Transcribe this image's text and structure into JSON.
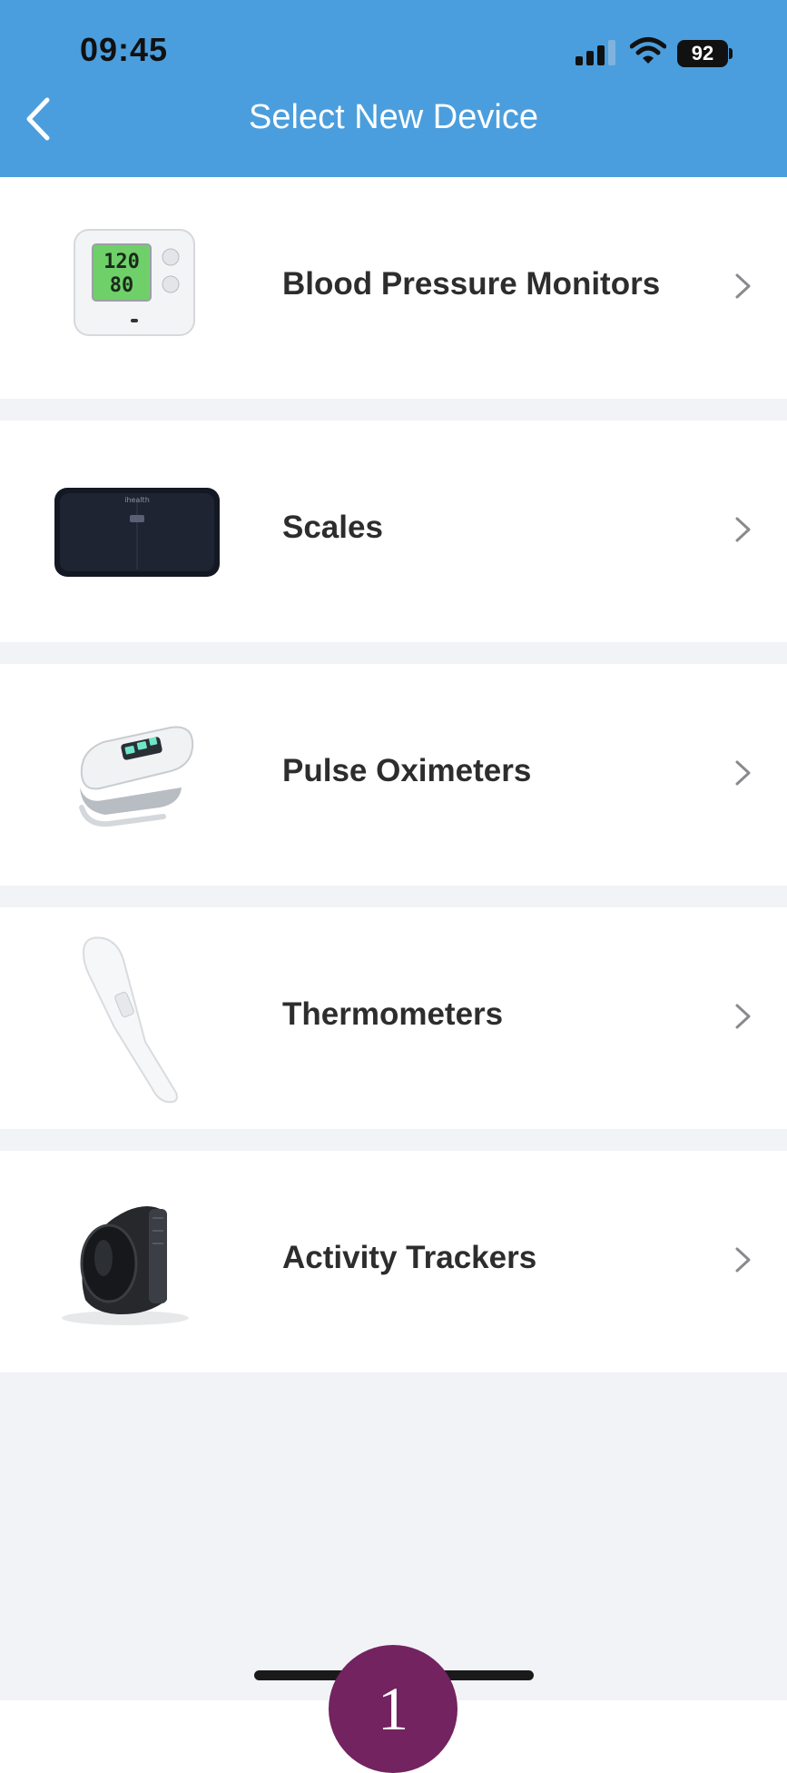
{
  "status_bar": {
    "time": "09:45",
    "battery": "92",
    "icons": [
      "cellular-signal-icon",
      "wifi-icon",
      "battery-icon"
    ]
  },
  "nav": {
    "title": "Select New Device",
    "back_icon": "chevron-left-icon"
  },
  "devices": [
    {
      "label": "Blood Pressure Monitors",
      "image": "blood-pressure-monitor-image",
      "display": [
        "120",
        "80"
      ]
    },
    {
      "label": "Scales",
      "image": "smart-scale-image"
    },
    {
      "label": "Pulse Oximeters",
      "image": "pulse-oximeter-image"
    },
    {
      "label": "Thermometers",
      "image": "thermometer-image"
    },
    {
      "label": "Activity Trackers",
      "image": "activity-tracker-image"
    }
  ],
  "step_badge": "1",
  "colors": {
    "header": "#4b9edd",
    "background": "#f2f3f7",
    "row": "#ffffff",
    "badge": "#73235f"
  }
}
